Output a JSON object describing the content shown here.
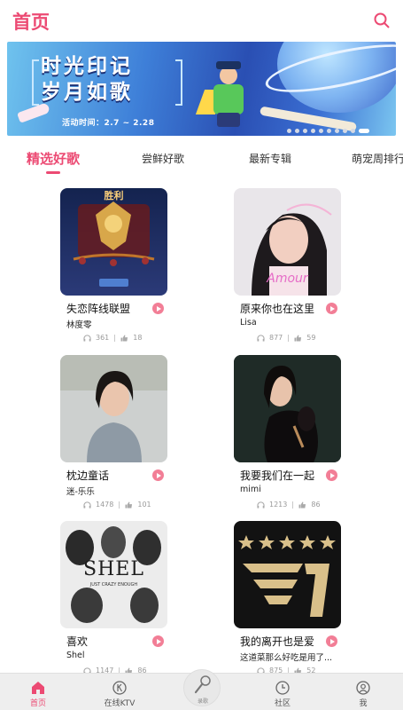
{
  "header": {
    "title": "首页",
    "search_icon": "search-icon"
  },
  "banner": {
    "title_line1": "时光印记",
    "title_line2": "岁月如歌",
    "date_text": "活动时间：2.7 ~ 2.28",
    "slide_count": 10,
    "active_slide": 9
  },
  "tabs": [
    {
      "label": "精选好歌",
      "active": true
    },
    {
      "label": "尝鲜好歌",
      "active": false
    },
    {
      "label": "最新专辑",
      "active": false
    },
    {
      "label": "萌宠周排行",
      "active": false
    }
  ],
  "songs": [
    {
      "title": "失恋阵线联盟",
      "artist": "林度零",
      "plays": "361",
      "likes": "18",
      "cover_caption": "胜利"
    },
    {
      "title": "原来你也在这里",
      "artist": "Lisa",
      "plays": "877",
      "likes": "59",
      "cover_caption": "Amour"
    },
    {
      "title": "枕边童话",
      "artist": "迷-乐乐",
      "plays": "1478",
      "likes": "101",
      "cover_caption": ""
    },
    {
      "title": "我要我们在一起",
      "artist": "mimi",
      "plays": "1213",
      "likes": "86",
      "cover_caption": ""
    },
    {
      "title": "喜欢",
      "artist": "Shel",
      "plays": "1147",
      "likes": "86",
      "cover_caption": "SHEL",
      "cover_subcaption": "JUST CRAZY ENOUGH"
    },
    {
      "title": "我的离开也是爱",
      "artist": "这道菜那么好吃是用了...",
      "plays": "875",
      "likes": "52",
      "cover_caption": "T1"
    }
  ],
  "bottom_nav": {
    "items": [
      {
        "label": "首页",
        "icon": "home-icon",
        "active": true
      },
      {
        "label": "在线KTV",
        "icon": "ktv-icon",
        "active": false
      },
      {
        "label": "社区",
        "icon": "clock-icon",
        "active": false
      },
      {
        "label": "我",
        "icon": "user-icon",
        "active": false
      }
    ],
    "center": {
      "label": "录歌",
      "icon": "microphone-icon"
    }
  },
  "colors": {
    "accent": "#ec4a73",
    "play_button": "#f27e96",
    "nav_bg": "#eeeeee"
  }
}
